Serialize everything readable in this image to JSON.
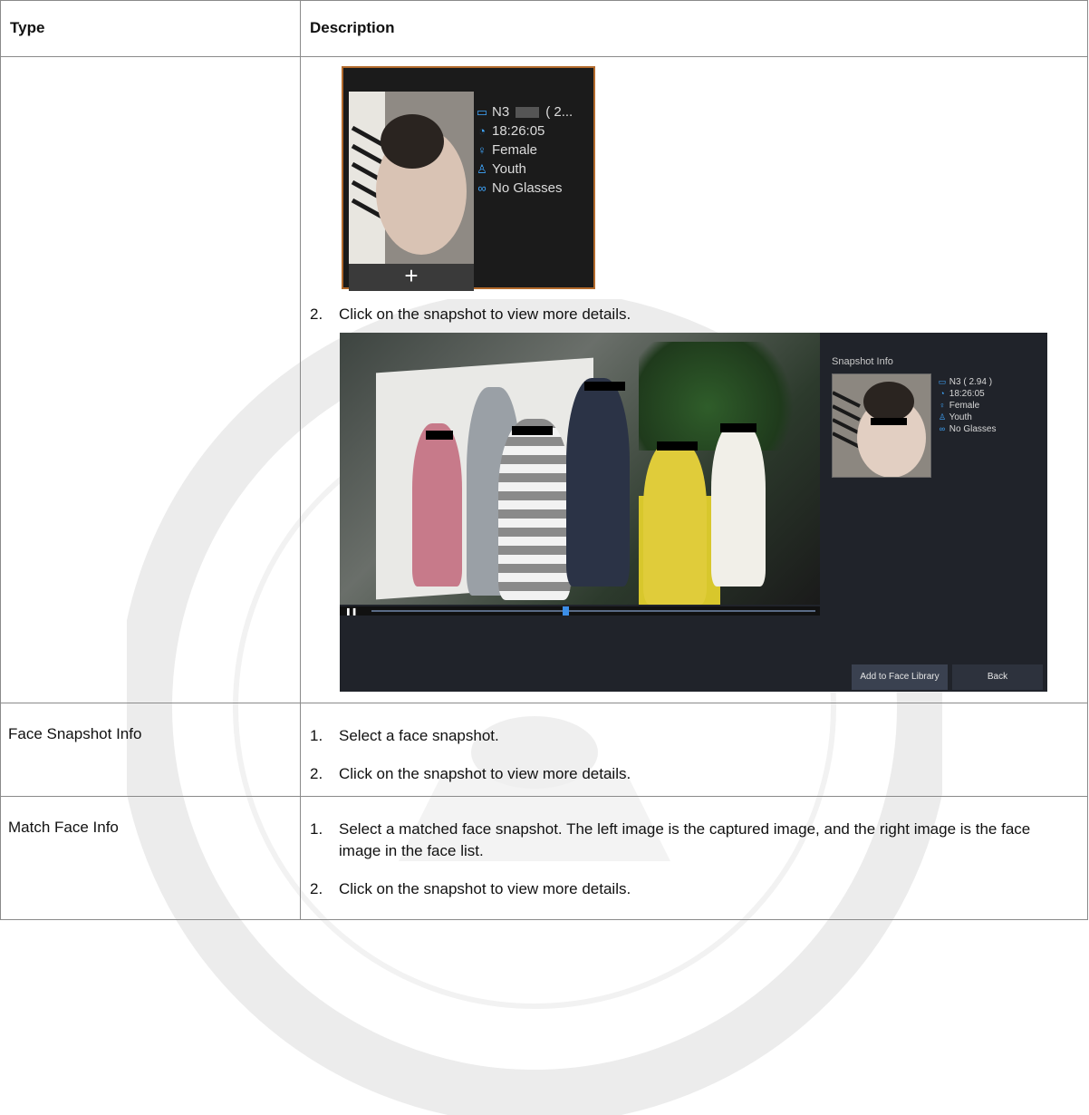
{
  "table": {
    "header": {
      "type": "Type",
      "description": "Description"
    },
    "rows": [
      {
        "type": "",
        "snapshot_card": {
          "channel": "N3",
          "channel_suffix": "( 2...",
          "time": "18:26:05",
          "gender": "Female",
          "age": "Youth",
          "glasses": "No Glasses",
          "add_symbol": "+"
        },
        "step2": {
          "num": "2.",
          "text": "Click on the snapshot to view more details."
        },
        "playback": {
          "side_title": "Snapshot Info",
          "channel": "N3",
          "channel_suffix": "( 2.94 )",
          "time": "18:26:05",
          "gender": "Female",
          "age": "Youth",
          "glasses": "No Glasses",
          "add_button": "Add to Face Library",
          "back_button": "Back",
          "playhead_fraction": 0.43
        }
      },
      {
        "type": "Face Snapshot Info",
        "steps": [
          {
            "num": "1.",
            "text": "Select a face snapshot."
          },
          {
            "num": "2.",
            "text": "Click on the snapshot to view more details."
          }
        ]
      },
      {
        "type": "Match Face Info",
        "steps": [
          {
            "num": "1.",
            "text": "Select a matched face snapshot. The left image is the captured image, and the right image is the face image in the face list."
          },
          {
            "num": "2.",
            "text": "Click on the snapshot to view more details."
          }
        ]
      }
    ]
  },
  "colors": {
    "border": "#8a8a8a",
    "accent_blue": "#3fa7ff",
    "card_border": "#b36a2c"
  },
  "icons": [
    "camera-icon",
    "clock-icon",
    "gender-icon",
    "person-icon",
    "glasses-icon"
  ]
}
